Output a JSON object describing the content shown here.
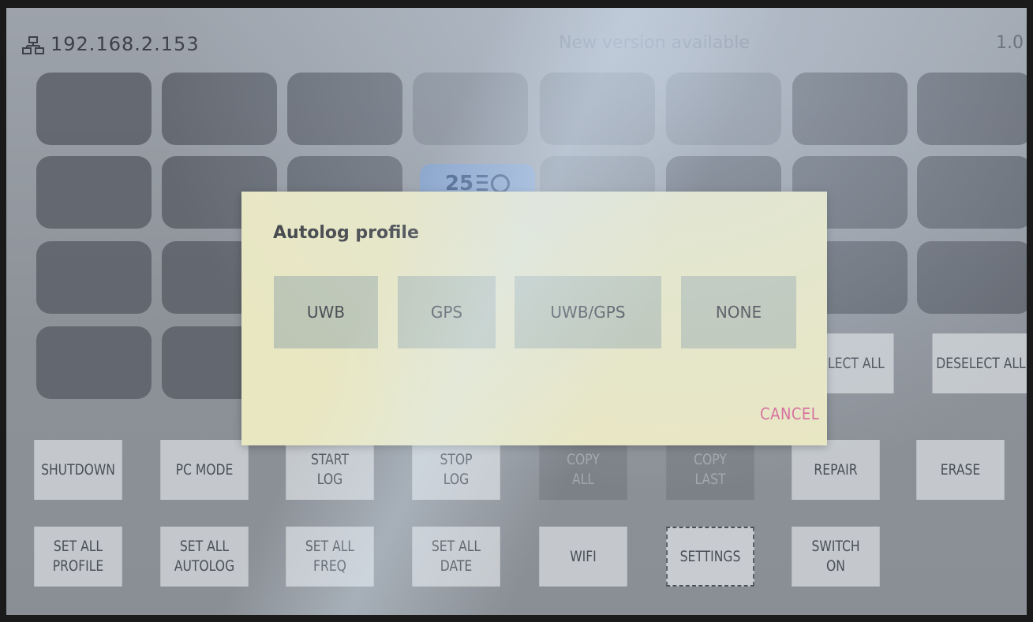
{
  "status": {
    "ip": "192.168.2.153",
    "version_notice": "New version available",
    "version": "1.0",
    "network_icon": "network-icon"
  },
  "badge": {
    "value": "25",
    "icons": [
      "battery-icon",
      "sync-icon"
    ]
  },
  "dialog": {
    "title": "Autolog profile",
    "options": [
      "UWB",
      "GPS",
      "UWB/GPS",
      "NONE"
    ],
    "cancel": "CANCEL",
    "cancel_color": "#d76a9a"
  },
  "select_buttons": {
    "select_all": "ELECT ALL",
    "deselect_all": "DESELECT ALL"
  },
  "action_row": [
    "SHUTDOWN",
    "PC MODE",
    "START\nLOG",
    "STOP\nLOG",
    "COPY\nALL",
    "COPY\nLAST",
    "REPAIR",
    "ERASE"
  ],
  "settings_row": [
    "SET ALL\nPROFILE",
    "SET ALL\nAUTOLOG",
    "SET ALL\nFREQ",
    "SET ALL\nDATE",
    "WIFI",
    "SETTINGS",
    "SWITCH\nON"
  ]
}
